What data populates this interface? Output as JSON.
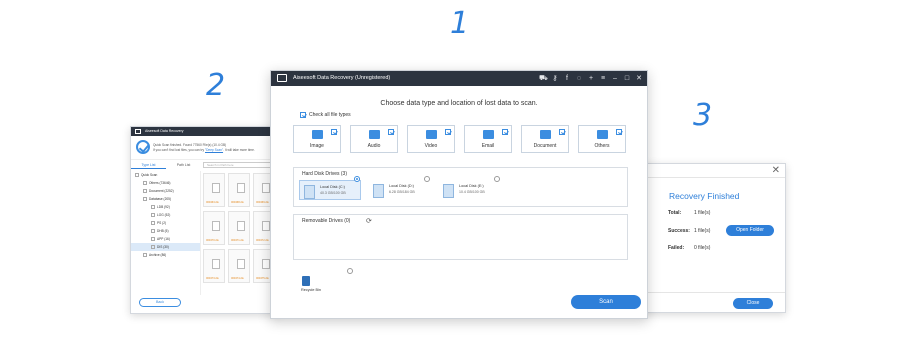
{
  "steps": [
    "1",
    "2",
    "3"
  ],
  "main": {
    "title": "Aiseesoft Data Recovery (Unregistered)",
    "heading": "Choose data type and location of lost data to scan.",
    "check_all": "Check all file types",
    "file_types": [
      "Image",
      "Audio",
      "Video",
      "Email",
      "Document",
      "Others"
    ],
    "hdd_header": "Hard Disk Drives (3)",
    "drives": [
      {
        "name": "Local Disk (C:)",
        "size": "40.3 GB/100 GB",
        "selected": true
      },
      {
        "name": "Local Disk (D:)",
        "size": "6.28 GB/184 GB",
        "selected": false
      },
      {
        "name": "Local Disk (E:)",
        "size": "10.4 GB/100 GB",
        "selected": false
      }
    ],
    "removable_header": "Removable Drives (0)",
    "recycle": "Recycle Bin",
    "scan_label": "Scan",
    "title_icons": [
      "cart-icon",
      "key-icon",
      "facebook-icon",
      "chat-icon",
      "plus-icon",
      "menu-icon",
      "minimize-icon",
      "maximize-icon",
      "close-icon"
    ]
  },
  "scan": {
    "title": "Aiseesoft Data Recovery",
    "status_line1": "Quick Scan finished. Found 77560 File(s) (10.4 GB)",
    "status_line2_pre": "If you can't find lost files, you can try",
    "status_link": "\"Deep Scan\"",
    "status_line2_post": ". It will take more time.",
    "tabs": [
      "Type List",
      "Path List"
    ],
    "search_placeholder": "Search in Path here",
    "tree": [
      {
        "label": "Quick Scan",
        "indent": 0,
        "selected": false
      },
      {
        "label": "Others (73646)",
        "indent": 1,
        "selected": false
      },
      {
        "label": "Document (2252)",
        "indent": 1,
        "selected": false
      },
      {
        "label": "Database (205)",
        "indent": 1,
        "selected": false
      },
      {
        "label": "LDB (92)",
        "indent": 2,
        "selected": false
      },
      {
        "label": "LOG (52)",
        "indent": 2,
        "selected": false
      },
      {
        "label": "PS (2)",
        "indent": 2,
        "selected": false
      },
      {
        "label": "DHB (5)",
        "indent": 2,
        "selected": false
      },
      {
        "label": "APP (16)",
        "indent": 2,
        "selected": false
      },
      {
        "label": "DIS (30)",
        "indent": 2,
        "selected": true
      },
      {
        "label": "Archive (86)",
        "indent": 1,
        "selected": false
      }
    ],
    "thumbs": [
      "000463.dis",
      "000468.dis",
      "000469.dis",
      "000470.dis",
      "000471.dis",
      "000472.dis",
      "000473.dis",
      "000474.dis",
      "000475.dis"
    ],
    "back_label": "Back"
  },
  "finish": {
    "title": "Recovery Finished",
    "total_label": "Total:",
    "total_value": "1 file(s)",
    "success_label": "Success:",
    "success_value": "1 file(s)",
    "failed_label": "Failed:",
    "failed_value": "0 file(s)",
    "open_folder_label": "Open Folder",
    "close_label": "Close"
  }
}
